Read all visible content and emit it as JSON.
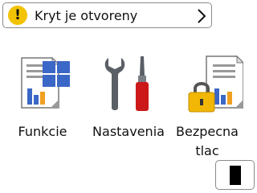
{
  "status": {
    "message": "Kryt je otvoreny",
    "icon": "warning-icon",
    "icon_glyph": "!",
    "icon_color": "#f2c300"
  },
  "tiles": [
    {
      "label": "Funkcie",
      "icon": "functions-icon"
    },
    {
      "label": "Nastavenia",
      "icon": "settings-tools-icon"
    },
    {
      "label": "Bezpecna\ntlac",
      "label_line1": "Bezpecna",
      "label_line2": "tlac",
      "icon": "secure-print-icon"
    }
  ],
  "toner_button": {
    "icon": "toner-cartridge-icon"
  },
  "colors": {
    "accent_blue": "#3b67c7",
    "tool_red": "#cc1818",
    "tool_gray": "#5a5f66",
    "lock_gold": "#f2b705"
  }
}
